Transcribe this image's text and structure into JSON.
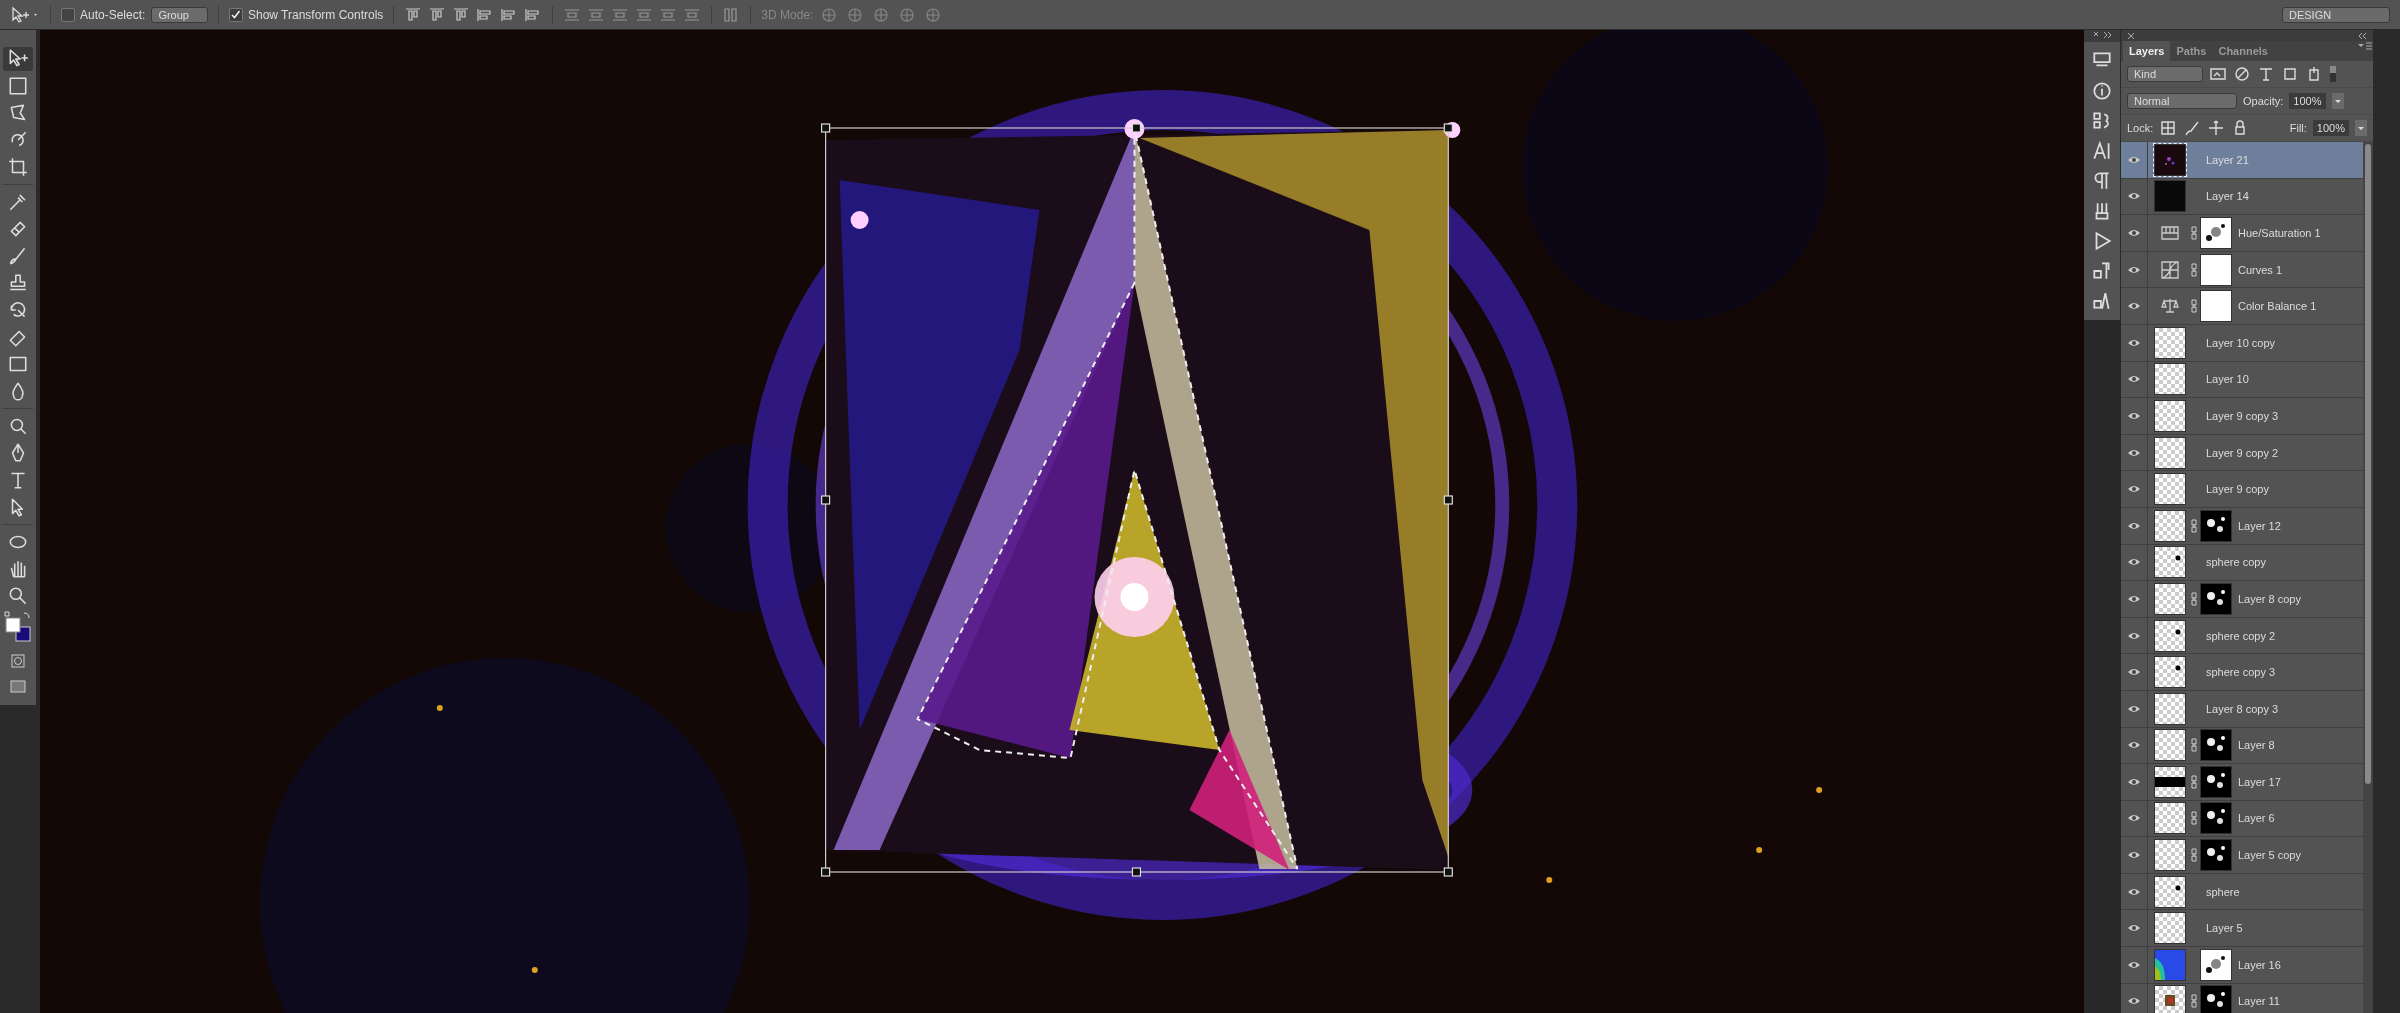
{
  "options_bar": {
    "auto_select": {
      "label": "Auto-Select:",
      "checked": false
    },
    "auto_select_target": "Group",
    "show_transform_controls": {
      "label": "Show Transform Controls",
      "checked": true
    },
    "mode_3d_label": "3D Mode:",
    "workspace": "DESIGN"
  },
  "toolbar": {
    "tools": [
      {
        "kind": "move",
        "selected": true
      },
      {
        "kind": "marquee",
        "selected": false
      },
      {
        "kind": "lasso",
        "selected": false
      },
      {
        "kind": "quick_select",
        "selected": false
      },
      {
        "kind": "crop",
        "selected": false
      },
      {
        "kind": "eyedropper",
        "selected": false
      },
      {
        "kind": "healing",
        "selected": false
      },
      {
        "kind": "brush",
        "selected": false
      },
      {
        "kind": "stamp",
        "selected": false
      },
      {
        "kind": "history",
        "selected": false
      },
      {
        "kind": "eraser",
        "selected": false
      },
      {
        "kind": "gradient",
        "selected": false
      },
      {
        "kind": "blur",
        "selected": false
      },
      {
        "kind": "dodge",
        "selected": false
      },
      {
        "kind": "pen",
        "selected": false
      },
      {
        "kind": "type",
        "selected": false
      },
      {
        "kind": "path_select",
        "selected": false
      },
      {
        "kind": "ellipse",
        "selected": false
      },
      {
        "kind": "hand",
        "selected": false
      },
      {
        "kind": "zoom",
        "selected": false
      }
    ]
  },
  "layers_panel": {
    "tabs": [
      {
        "label": "Layers",
        "selected": true
      },
      {
        "label": "Paths",
        "selected": false
      },
      {
        "label": "Channels",
        "selected": false
      }
    ],
    "filter": "Kind",
    "blend_mode": "Normal",
    "opacity_label": "Opacity:",
    "opacity": "100%",
    "lock_label": "Lock:",
    "fill_label": "Fill:",
    "fill": "100%",
    "layers": [
      {
        "name": "Layer 21",
        "kind": "pixel",
        "thumbnail": {
          "kind": "artwork"
        },
        "linked": false,
        "visible": true,
        "selected": true
      },
      {
        "name": "Layer 14",
        "kind": "pixel",
        "thumbnail": {
          "kind": "black"
        },
        "linked": false,
        "visible": true,
        "selected": false
      },
      {
        "name": "Hue/Saturation 1",
        "kind": "hue_saturation",
        "mask": {
          "kind": "light"
        },
        "linked": true,
        "visible": true,
        "selected": false
      },
      {
        "name": "Curves 1",
        "kind": "curves",
        "mask": {
          "kind": "white"
        },
        "linked": true,
        "visible": true,
        "selected": false
      },
      {
        "name": "Color Balance 1",
        "kind": "color_balance",
        "mask": {
          "kind": "white"
        },
        "linked": true,
        "visible": true,
        "selected": false
      },
      {
        "name": "Layer 10 copy",
        "kind": "pixel",
        "thumbnail": {
          "kind": "transparent"
        },
        "linked": false,
        "visible": true,
        "selected": false
      },
      {
        "name": "Layer 10",
        "kind": "pixel",
        "thumbnail": {
          "kind": "transparent"
        },
        "linked": false,
        "visible": true,
        "selected": false
      },
      {
        "name": "Layer 9 copy 3",
        "kind": "pixel",
        "thumbnail": {
          "kind": "transparent"
        },
        "linked": false,
        "visible": true,
        "selected": false
      },
      {
        "name": "Layer 9 copy 2",
        "kind": "pixel",
        "thumbnail": {
          "kind": "transparent"
        },
        "linked": false,
        "visible": true,
        "selected": false
      },
      {
        "name": "Layer 9 copy",
        "kind": "pixel",
        "thumbnail": {
          "kind": "transparent"
        },
        "linked": false,
        "visible": true,
        "selected": false
      },
      {
        "name": "Layer 12",
        "kind": "pixel",
        "thumbnail": {
          "kind": "transparent"
        },
        "mask": {
          "kind": "dark"
        },
        "linked": true,
        "visible": true,
        "selected": false
      },
      {
        "name": "sphere copy",
        "kind": "pixel",
        "thumbnail": {
          "kind": "dot"
        },
        "linked": false,
        "visible": true,
        "selected": false
      },
      {
        "name": "Layer 8 copy",
        "kind": "pixel",
        "thumbnail": {
          "kind": "transparent"
        },
        "mask": {
          "kind": "dark"
        },
        "linked": true,
        "visible": true,
        "selected": false
      },
      {
        "name": "sphere copy 2",
        "kind": "pixel",
        "thumbnail": {
          "kind": "dot"
        },
        "linked": false,
        "visible": true,
        "selected": false
      },
      {
        "name": "sphere copy 3",
        "kind": "pixel",
        "thumbnail": {
          "kind": "dot"
        },
        "linked": false,
        "visible": true,
        "selected": false
      },
      {
        "name": "Layer 8 copy 3",
        "kind": "pixel",
        "thumbnail": {
          "kind": "transparent"
        },
        "linked": false,
        "visible": true,
        "selected": false
      },
      {
        "name": "Layer 8",
        "kind": "pixel",
        "thumbnail": {
          "kind": "transparent"
        },
        "mask": {
          "kind": "dark"
        },
        "linked": true,
        "visible": true,
        "selected": false
      },
      {
        "name": "Layer 17",
        "kind": "pixel",
        "thumbnail": {
          "kind": "band"
        },
        "mask": {
          "kind": "dark"
        },
        "linked": true,
        "visible": true,
        "selected": false
      },
      {
        "name": "Layer 6",
        "kind": "pixel",
        "thumbnail": {
          "kind": "transparent"
        },
        "mask": {
          "kind": "dark"
        },
        "linked": true,
        "visible": true,
        "selected": false
      },
      {
        "name": "Layer 5 copy",
        "kind": "pixel",
        "thumbnail": {
          "kind": "transparent"
        },
        "mask": {
          "kind": "dark"
        },
        "linked": true,
        "visible": true,
        "selected": false
      },
      {
        "name": "sphere",
        "kind": "pixel",
        "thumbnail": {
          "kind": "dot"
        },
        "linked": false,
        "visible": true,
        "selected": false
      },
      {
        "name": "Layer 5",
        "kind": "pixel",
        "thumbnail": {
          "kind": "transparent"
        },
        "linked": false,
        "visible": true,
        "selected": false
      },
      {
        "name": "Layer 16",
        "kind": "pixel",
        "thumbnail": {
          "kind": "gradient"
        },
        "mask": {
          "kind": "light"
        },
        "linked": false,
        "visible": true,
        "selected": false
      },
      {
        "name": "Layer 11",
        "kind": "pixel",
        "thumbnail": {
          "kind": "image"
        },
        "mask": {
          "kind": "dark"
        },
        "linked": true,
        "visible": true,
        "selected": false
      }
    ]
  }
}
